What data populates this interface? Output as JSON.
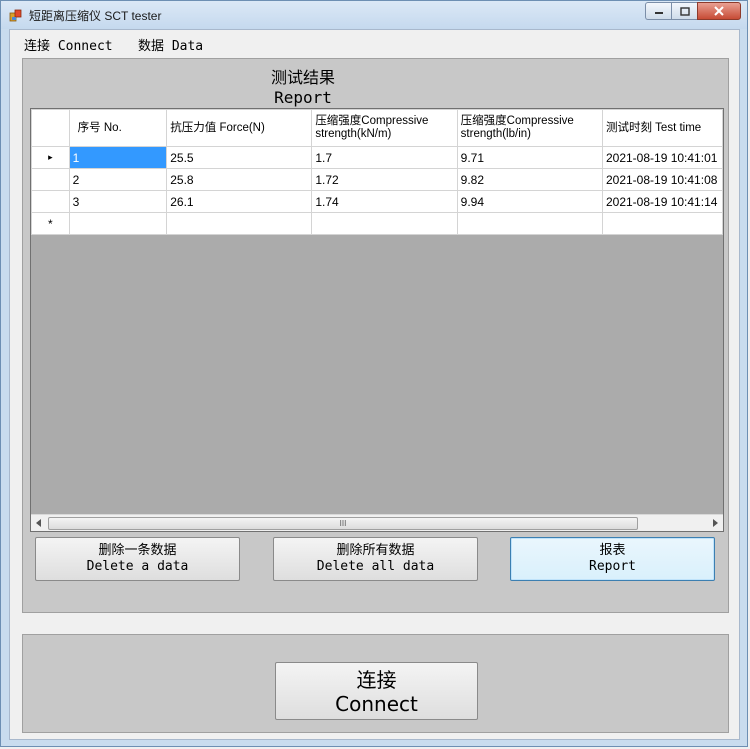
{
  "window": {
    "title": "短距离压缩仪 SCT tester"
  },
  "menu": [
    {
      "label": "连接 Connect"
    },
    {
      "label": "数据 Data"
    }
  ],
  "results": {
    "heading_cn": "测试结果",
    "heading_en": "Report",
    "columns": [
      "序号 No.",
      "抗压力值 Force(N)",
      "压缩强度Compressive strength(kN/m)",
      "压缩强度Compressive strength(lb/in)",
      "测试时刻 Test time"
    ],
    "rows": [
      [
        "1",
        "25.5",
        "1.7",
        "9.71",
        "2021-08-19 10:41:01"
      ],
      [
        "2",
        "25.8",
        "1.72",
        "9.82",
        "2021-08-19 10:41:08"
      ],
      [
        "3",
        "26.1",
        "1.74",
        "9.94",
        "2021-08-19 10:41:14"
      ]
    ],
    "new_row_marker": "*",
    "current_row_marker": "▸",
    "scroll_grip": "III"
  },
  "buttons": {
    "delete_one": {
      "cn": "删除一条数据",
      "en": "Delete a data"
    },
    "delete_all": {
      "cn": "删除所有数据",
      "en": "Delete all data"
    },
    "report": {
      "cn": "报表",
      "en": "Report"
    },
    "connect": {
      "cn": "连接",
      "en": "Connect"
    }
  },
  "icons": {
    "minimize": "minimize-icon",
    "maximize": "maximize-icon",
    "close": "close-icon"
  }
}
